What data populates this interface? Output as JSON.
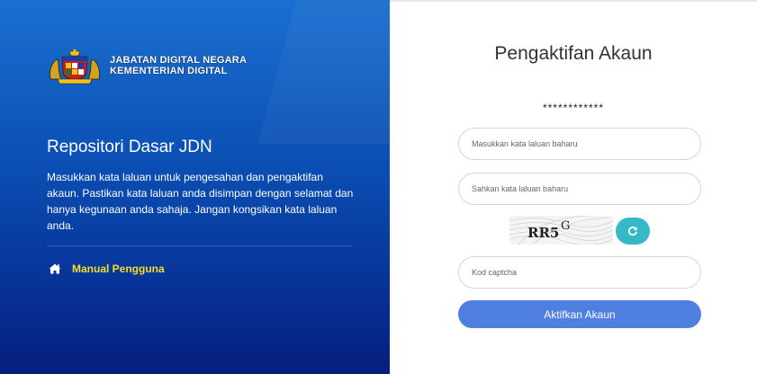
{
  "brand": {
    "agency_line1": "JABATAN DIGITAL NEGARA",
    "agency_line2": "KEMENTERIAN DIGITAL",
    "logo_icon": "malaysia-coat-of-arms-icon"
  },
  "sidebar": {
    "title": "Repositori Dasar JDN",
    "description": "Masukkan kata laluan untuk pengesahan dan pengaktifan akaun. Pastikan kata laluan anda disimpan dengan selamat dan hanya kegunaan anda sahaja. Jangan kongsikan kata laluan anda.",
    "manual_link": "Manual Pengguna",
    "manual_icon": "home-icon"
  },
  "form": {
    "heading": "Pengaktifan Akaun",
    "masked_password": "************",
    "new_password_placeholder": "Masukkan kata laluan baharu",
    "confirm_password_placeholder": "Sahkan kata laluan baharu",
    "captcha_text": "RR5",
    "captcha_superscript": "G",
    "captcha_placeholder": "Kod captcha",
    "refresh_icon": "refresh-icon",
    "submit_label": "Aktifkan Akaun"
  },
  "colors": {
    "panel_gradient_top": "#1a6fd0",
    "panel_gradient_bottom": "#051f7e",
    "link_yellow": "#f3de2c",
    "refresh_button": "#36b8c9",
    "submit_button": "#4f7fe0"
  }
}
